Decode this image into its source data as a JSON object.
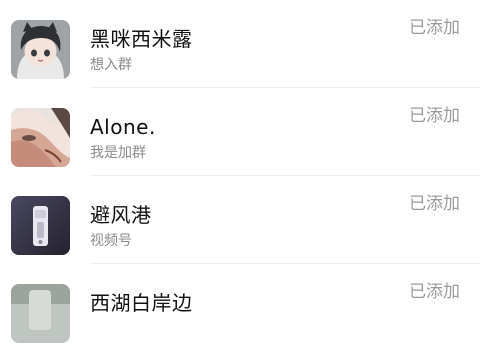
{
  "friend_requests": [
    {
      "name": "黑咪西米露",
      "note": "想入群",
      "status": "已添加",
      "avatar": "anime-cat-girl-avatar"
    },
    {
      "name": "Alone.",
      "note": "我是加群",
      "status": "已添加",
      "avatar": "face-closeup-avatar"
    },
    {
      "name": "避风港",
      "note": "视频号",
      "status": "已添加",
      "avatar": "lighter-photo-avatar"
    },
    {
      "name": "西湖白岸边",
      "note": "",
      "status": "已添加",
      "avatar": "partial-avatar"
    }
  ]
}
